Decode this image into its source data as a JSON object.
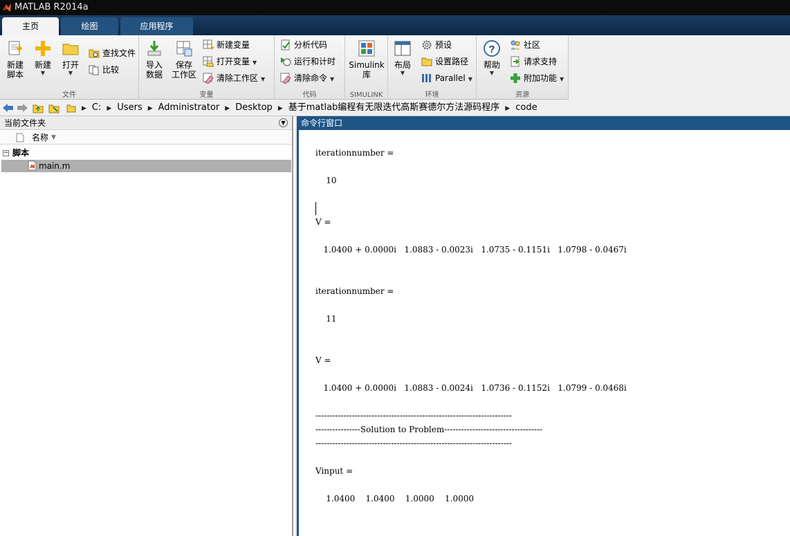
{
  "window": {
    "title": "MATLAB R2014a"
  },
  "tabs": [
    "主页",
    "绘图",
    "应用程序"
  ],
  "ribbon": {
    "file": {
      "label": "文件",
      "new_script": [
        "新建",
        "脚本"
      ],
      "new": "新建",
      "open": "打开",
      "find_files": "查找文件",
      "compare": "比较"
    },
    "variable": {
      "label": "变量",
      "import": [
        "导入",
        "数据"
      ],
      "save": [
        "保存",
        "工作区"
      ],
      "new_var": "新建变量",
      "open_var": "打开变量",
      "clear_ws": "清除工作区"
    },
    "code": {
      "label": "代码",
      "analyze": "分析代码",
      "run_time": "运行和计时",
      "clear_cmd": "清除命令"
    },
    "simulink": {
      "label": "SIMULINK",
      "lib": [
        "Simulink",
        "库"
      ]
    },
    "environment": {
      "label": "环境",
      "layout": "布局",
      "prefs": "预设",
      "set_path": "设置路径",
      "parallel": "Parallel"
    },
    "resources": {
      "label": "资源",
      "help": "帮助",
      "community": "社区",
      "support": "请求支持",
      "addons": "附加功能"
    }
  },
  "address": {
    "crumbs": [
      "C:",
      "Users",
      "Administrator",
      "Desktop",
      "基于matlab编程有无限迭代高斯赛德尔方法源码程序",
      "code"
    ]
  },
  "current_folder": {
    "title": "当前文件夹",
    "column": "名称",
    "group": "脚本",
    "file": "main.m"
  },
  "command_window": {
    "title": "命令行窗口",
    "lines": [
      "iterationnumber =",
      "    10",
      "V =",
      "   1.0400 + 0.0000i   1.0883 - 0.0023i   1.0735 - 0.1151i   1.0798 - 0.0467i",
      "iterationnumber =",
      "    11",
      "V =",
      "   1.0400 + 0.0000i   1.0883 - 0.0024i   1.0736 - 0.1152i   1.0799 - 0.0468i",
      "----------------------------------------------------------------------",
      "----------------Solution to Problem-----------------------------------",
      "----------------------------------------------------------------------",
      "Vinput =",
      "    1.0400    1.0400    1.0000    1.0000"
    ]
  },
  "colors": {
    "titlebar": "#0c0c0c",
    "tabstrip": "#0c2745",
    "cmd_title": "#1e5585",
    "selected_row": "#b0b0b0"
  }
}
